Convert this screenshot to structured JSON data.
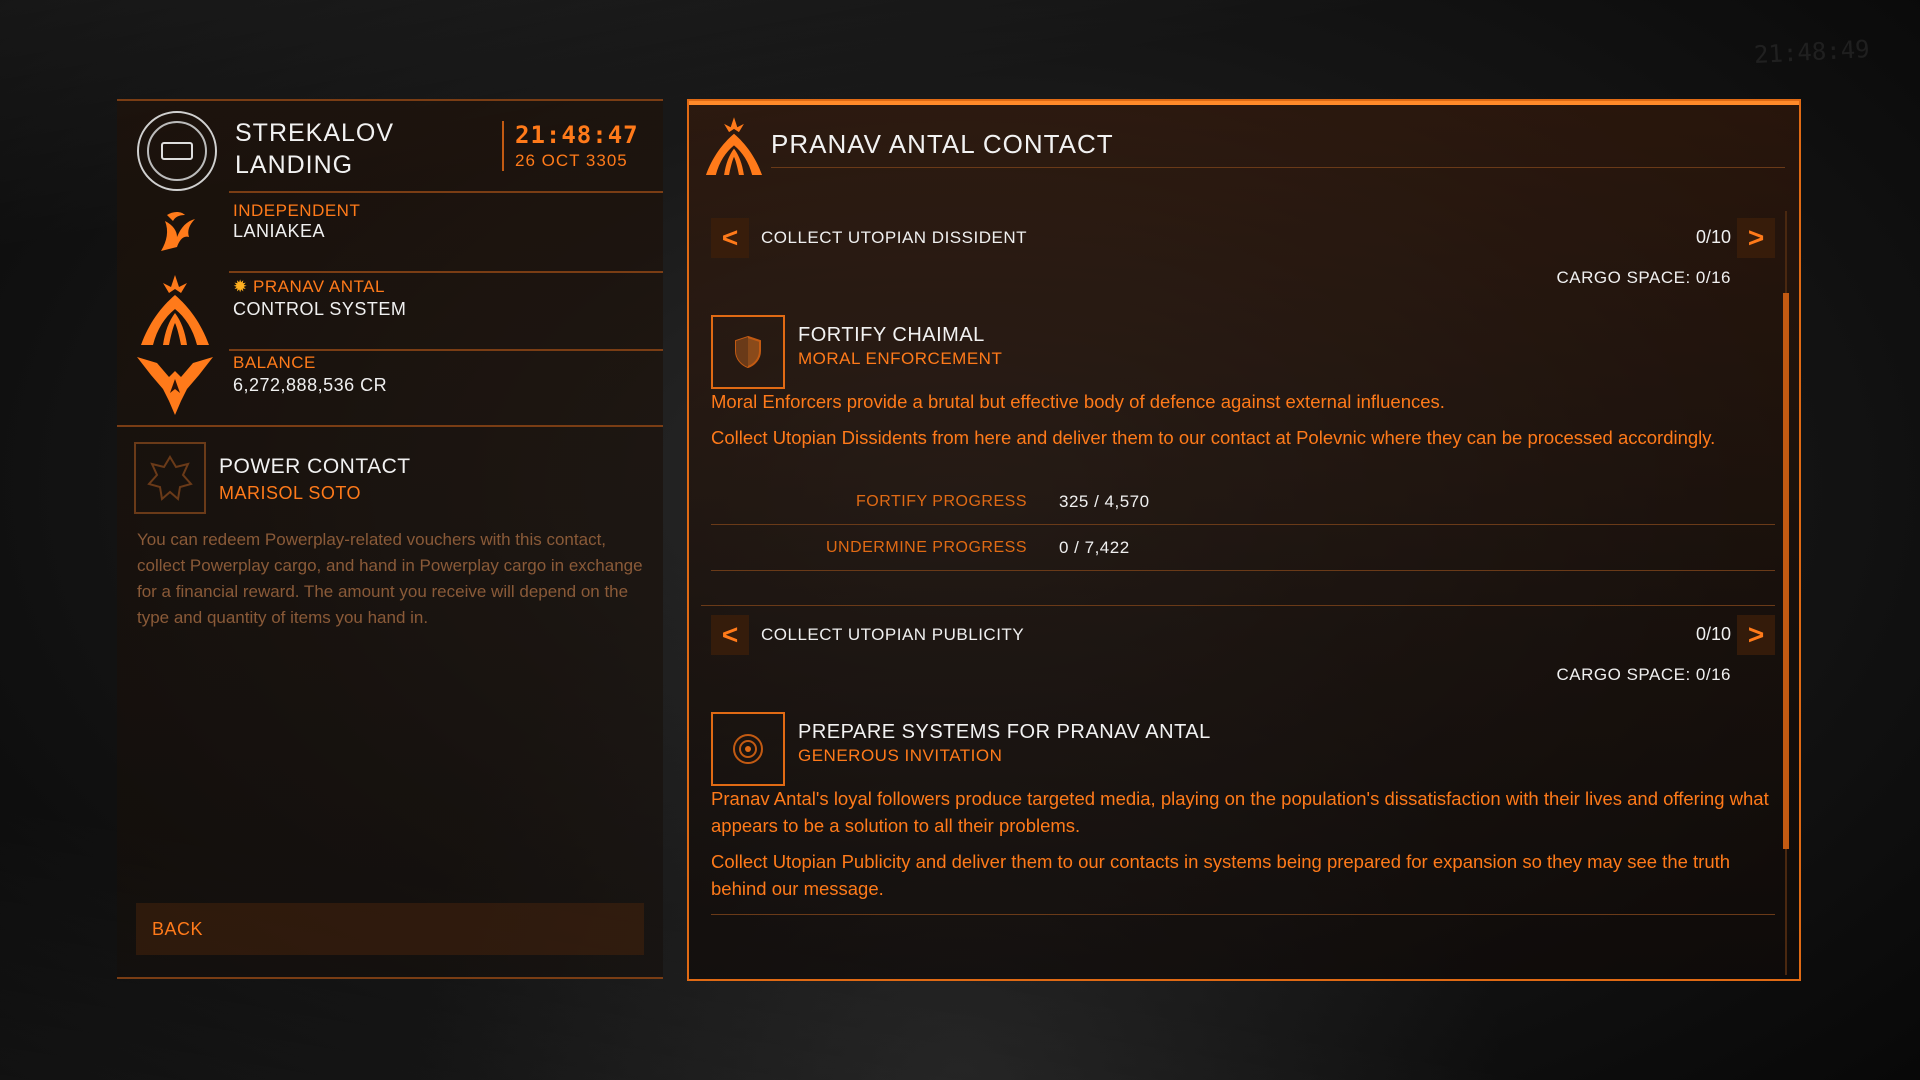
{
  "background": {
    "clock": "21:48:49"
  },
  "station": {
    "name_line1": "STREKALOV",
    "name_line2": "LANDING",
    "time": "21:48:47",
    "date": "26 OCT 3305"
  },
  "faction": {
    "allegiance": "INDEPENDENT",
    "name": "LANIAKEA"
  },
  "power": {
    "name": "PRANAV ANTAL",
    "status": "CONTROL SYSTEM"
  },
  "balance": {
    "label": "BALANCE",
    "value": "6,272,888,536 CR"
  },
  "contact": {
    "title": "POWER CONTACT",
    "name": "MARISOL SOTO",
    "description": "You can redeem Powerplay-related vouchers with this contact, collect Powerplay cargo, and hand in Powerplay cargo in exchange for a financial reward. The amount you receive will depend on the type and quantity of items you hand in."
  },
  "back_label": "BACK",
  "panel": {
    "title": "PRANAV ANTAL CONTACT"
  },
  "sections": [
    {
      "nav_label": "COLLECT UTOPIAN DISSIDENT",
      "count": "0/10",
      "cargo": "CARGO SPACE: 0/16",
      "task_title": "FORTIFY CHAIMAL",
      "task_sub": "MORAL ENFORCEMENT",
      "para1": "Moral Enforcers provide a brutal but effective body of defence against external influences.",
      "para2": "Collect Utopian Dissidents from here and deliver them to our contact at Polevnic where they can be processed accordingly.",
      "fortify_label": "FORTIFY PROGRESS",
      "fortify_value": "325 / 4,570",
      "undermine_label": "UNDERMINE PROGRESS",
      "undermine_value": "0 / 7,422"
    },
    {
      "nav_label": "COLLECT UTOPIAN PUBLICITY",
      "count": "0/10",
      "cargo": "CARGO SPACE: 0/16",
      "task_title": "PREPARE SYSTEMS FOR PRANAV ANTAL",
      "task_sub": "GENEROUS INVITATION",
      "para1": "Pranav Antal's loyal followers produce targeted media, playing on the population's dissatisfaction with their lives and offering what appears to be a solution to all their problems.",
      "para2": "Collect Utopian Publicity and deliver them to our contacts in systems being prepared for expansion so they may see the truth behind our message."
    }
  ],
  "icons": {
    "station": "station-icon",
    "faction": "phoenix-icon",
    "power": "pranav-antal-icon",
    "balance": "wings-icon",
    "contact": "power-contact-icon",
    "fortify": "shield-icon",
    "prepare": "target-icon",
    "power_dot": "sun-icon"
  },
  "colors": {
    "accent": "#ff7a1a",
    "accent_dark": "#e06a14",
    "line": "#6a3a18"
  }
}
